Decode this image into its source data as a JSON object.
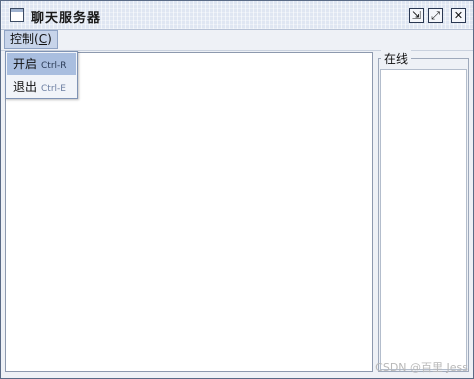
{
  "window": {
    "title": "聊天服务器",
    "buttons": {
      "iconify": "⇲",
      "maximize": "⤢",
      "close": "✕"
    }
  },
  "menubar": {
    "control": {
      "label": "控制(",
      "mnemonic": "C",
      "suffix": ")"
    }
  },
  "menu": {
    "items": [
      {
        "label": "开启",
        "accelerator": "Ctrl-R",
        "selected": true
      },
      {
        "label": "退出",
        "accelerator": "Ctrl-E",
        "selected": false
      }
    ]
  },
  "online_panel": {
    "title": "在线"
  },
  "watermark": "CSDN @百里 Jess",
  "colors": {
    "title_bar": "#dfe6f2",
    "selection": "#a9bedf",
    "border": "#5a6b86"
  }
}
